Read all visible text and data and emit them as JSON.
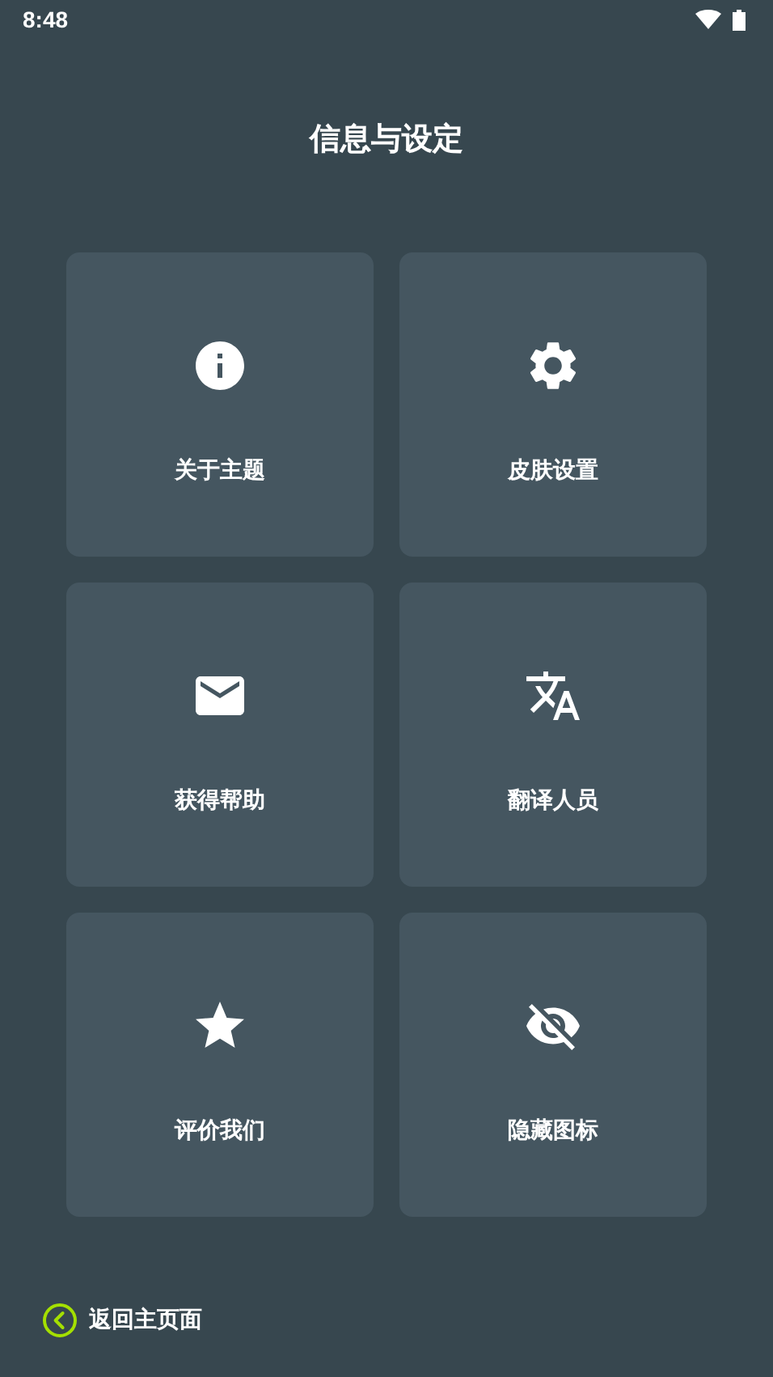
{
  "status_bar": {
    "time": "8:48"
  },
  "title": "信息与设定",
  "cards": [
    {
      "kind": "info",
      "label": "关于主题"
    },
    {
      "kind": "settings",
      "label": "皮肤设置"
    },
    {
      "kind": "mail",
      "label": "获得帮助"
    },
    {
      "kind": "translate",
      "label": "翻译人员"
    },
    {
      "kind": "star",
      "label": "评价我们"
    },
    {
      "kind": "hidden",
      "label": "隐藏图标"
    }
  ],
  "back_link": {
    "label": "返回主页面"
  }
}
